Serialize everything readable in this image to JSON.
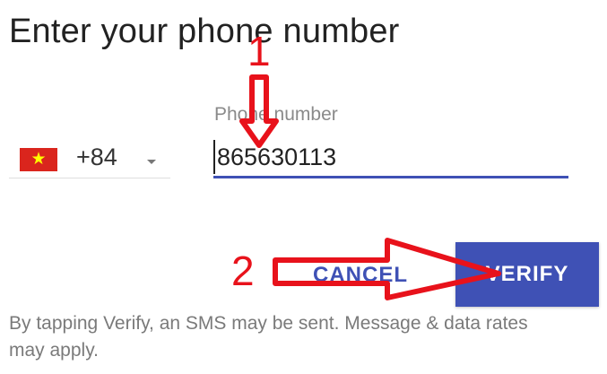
{
  "page": {
    "title": "Enter your phone number"
  },
  "country_selector": {
    "flag_icon": "vietnam-flag-icon",
    "flag_star": "★",
    "dial_code": "+84"
  },
  "phone": {
    "label": "Phone number",
    "value": "865630113"
  },
  "buttons": {
    "cancel": "CANCEL",
    "verify": "VERIFY"
  },
  "disclaimer": "By tapping Verify, an SMS may be sent. Message & data rates may apply.",
  "annotations": {
    "step1": "1",
    "step2": "2",
    "arrow_icons": [
      "down-arrow-annotation-icon",
      "right-arrow-annotation-icon"
    ]
  },
  "colors": {
    "accent": "#3f51b5",
    "annotation": "#e8121b",
    "flag_red": "#da251d",
    "flag_star": "#ffff00"
  }
}
